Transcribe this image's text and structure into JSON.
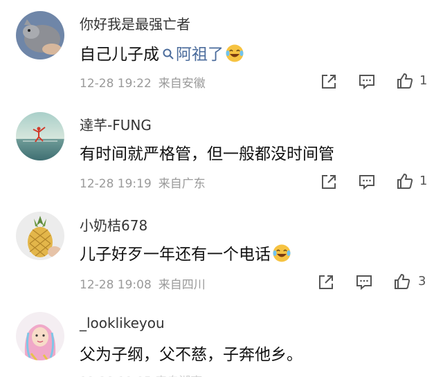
{
  "comments": [
    {
      "username": "你好我是最强亡者",
      "content_before": "自己儿子成",
      "link_text": "阿祖了",
      "content_after": "",
      "date": "12-28 19:22",
      "location": "来自安徽",
      "likes": "1",
      "avatar": "gray-cat-avatar",
      "emoji": "laugh-cry-emoji"
    },
    {
      "username": "達芊-FUNG",
      "content": "有时间就严格管，但一般都没时间管",
      "date": "12-28 19:19",
      "location": "来自广东",
      "likes": "1",
      "avatar": "dancer-on-water-avatar"
    },
    {
      "username": "小奶桔678",
      "content": "儿子好歹一年还有一个电话",
      "date": "12-28 19:08",
      "location": "来自四川",
      "likes": "3",
      "avatar": "pineapple-avatar",
      "emoji": "laugh-cry-emoji"
    },
    {
      "username": "_looklikeyou",
      "content": "父为子纲，父不慈，子奔他乡。",
      "avatar": "cartoon-girl-avatar"
    }
  ],
  "icons": {
    "share": "share-icon",
    "comment": "comment-icon",
    "like": "thumbs-up-icon",
    "search": "search-icon"
  },
  "colors": {
    "link": "#4a6b9b",
    "meta": "#9a9a9a",
    "emoji": "#f6c342"
  }
}
